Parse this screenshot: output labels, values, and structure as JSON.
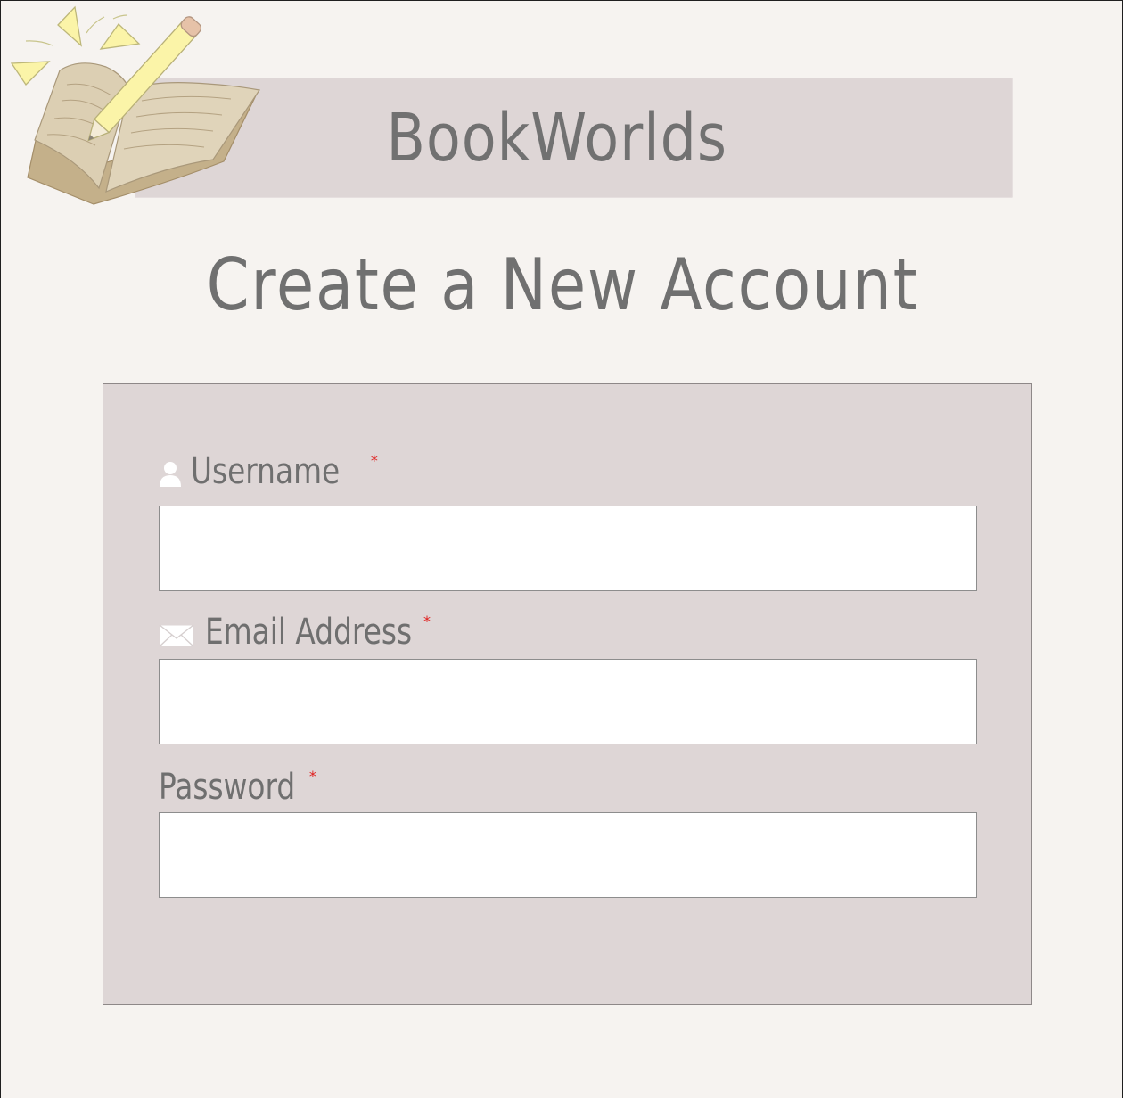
{
  "header": {
    "brand_name": "BookWorlds",
    "logo_icon": "open-book-pencil-icon"
  },
  "page": {
    "title": "Create a New Account"
  },
  "form": {
    "required_marker": "*",
    "fields": [
      {
        "id": "username",
        "label": "Username",
        "icon": "user-icon",
        "value": "",
        "required": true
      },
      {
        "id": "email",
        "label": "Email Address",
        "icon": "envelope-icon",
        "value": "",
        "required": true
      },
      {
        "id": "password",
        "label": "Password",
        "value": "",
        "required": true
      }
    ]
  },
  "colors": {
    "background": "#f6f3f0",
    "panel": "#ded6d6",
    "text": "#707070",
    "required": "#e0201f"
  }
}
